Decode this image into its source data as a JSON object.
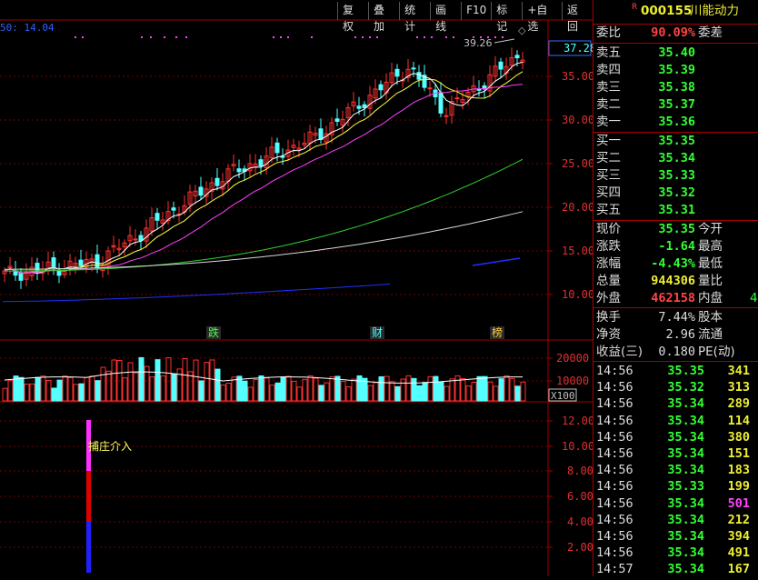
{
  "toolbar": {
    "items": [
      "复权",
      "叠加",
      "统计",
      "画线",
      "F10",
      "标记",
      "+自选",
      "返回"
    ]
  },
  "stock": {
    "flag": "R",
    "code": "000155",
    "name": "川能动力"
  },
  "chart": {
    "ma_legend": "50: 14.04",
    "high_label": "39.26",
    "current_price_tag": "37.28",
    "price_axis": [
      "35.00",
      "30.00",
      "25.00",
      "20.00",
      "15.00",
      "10.00"
    ],
    "volume_axis": [
      "20000",
      "10000"
    ],
    "volume_unit": "X100",
    "indicator_axis": [
      "12.00",
      "10.00",
      "8.00",
      "6.00",
      "4.00",
      "2.00"
    ],
    "events": [
      "跌",
      "财",
      "榜"
    ],
    "indicator_label": "捕庄介入"
  },
  "panel": {
    "weibi_label": "委比",
    "weibi_value": "90.09%",
    "weicha_label": "委差",
    "asks": [
      {
        "label": "卖五",
        "price": "35.40"
      },
      {
        "label": "卖四",
        "price": "35.39"
      },
      {
        "label": "卖三",
        "price": "35.38"
      },
      {
        "label": "卖二",
        "price": "35.37"
      },
      {
        "label": "卖一",
        "price": "35.36"
      }
    ],
    "bids": [
      {
        "label": "买一",
        "price": "35.35"
      },
      {
        "label": "买二",
        "price": "35.34"
      },
      {
        "label": "买三",
        "price": "35.33"
      },
      {
        "label": "买四",
        "price": "35.32"
      },
      {
        "label": "买五",
        "price": "35.31"
      }
    ],
    "stats": [
      {
        "label": "现价",
        "value": "35.35",
        "label2": "今开",
        "color": "#3f3"
      },
      {
        "label": "涨跌",
        "value": "-1.64",
        "label2": "最高",
        "color": "#3f3"
      },
      {
        "label": "涨幅",
        "value": "-4.43%",
        "label2": "最低",
        "color": "#3f3"
      },
      {
        "label": "总量",
        "value": "944306",
        "label2": "量比",
        "color": "#ee3"
      },
      {
        "label": "外盘",
        "value": "462158",
        "label2": "内盘",
        "color": "#f44",
        "extra": "4"
      }
    ],
    "stats2": [
      {
        "label": "换手",
        "value": "7.44%",
        "label2": "股本"
      },
      {
        "label": "净资",
        "value": "2.96",
        "label2": "流通"
      },
      {
        "label": "收益(三)",
        "value": "0.180",
        "label2": "PE(动)"
      }
    ],
    "ticks": [
      {
        "time": "14:56",
        "price": "35.35",
        "vol": "341"
      },
      {
        "time": "14:56",
        "price": "35.32",
        "vol": "313"
      },
      {
        "time": "14:56",
        "price": "35.34",
        "vol": "289"
      },
      {
        "time": "14:56",
        "price": "35.34",
        "vol": "114"
      },
      {
        "time": "14:56",
        "price": "35.34",
        "vol": "380"
      },
      {
        "time": "14:56",
        "price": "35.34",
        "vol": "151"
      },
      {
        "time": "14:56",
        "price": "35.34",
        "vol": "183"
      },
      {
        "time": "14:56",
        "price": "35.33",
        "vol": "199"
      },
      {
        "time": "14:56",
        "price": "35.34",
        "vol": "501"
      },
      {
        "time": "14:56",
        "price": "35.34",
        "vol": "212"
      },
      {
        "time": "14:56",
        "price": "35.34",
        "vol": "394"
      },
      {
        "time": "14:56",
        "price": "35.34",
        "vol": "491"
      },
      {
        "time": "14:57",
        "price": "35.34",
        "vol": "167"
      }
    ]
  },
  "colors": {
    "up": "#ff3030",
    "down": "#54ffff",
    "frame": "#a00000",
    "ma5": "#ffffff",
    "ma10": "#ffff40",
    "ma20": "#ff40ff",
    "ma60": "#30d030",
    "ma120": "#d8d8d8",
    "ma250": "#2030ff"
  }
}
